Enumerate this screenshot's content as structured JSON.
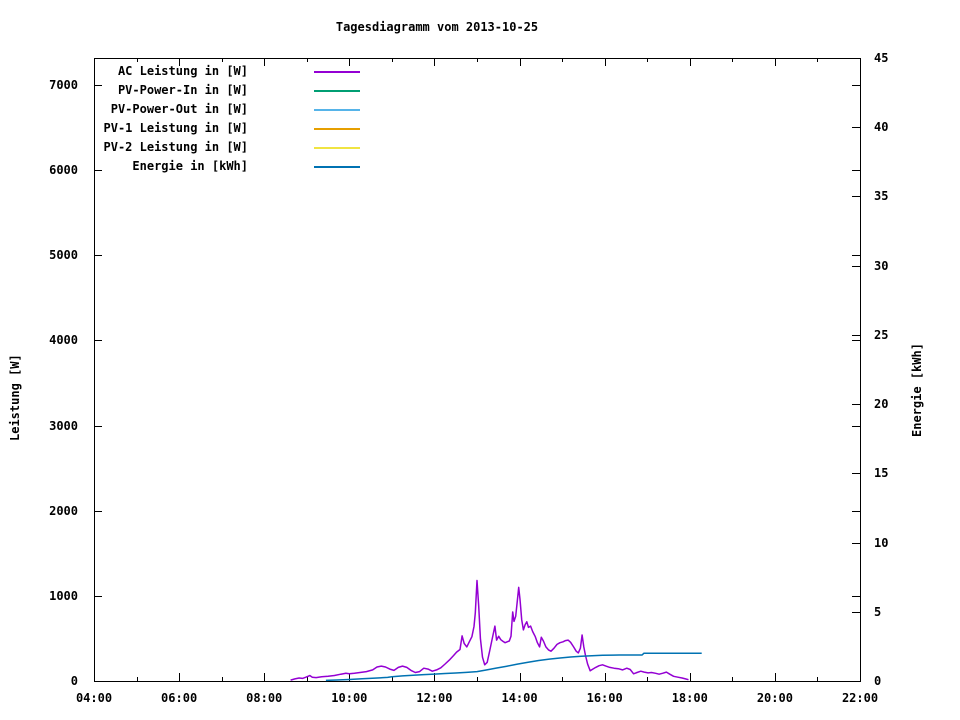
{
  "chart_data": {
    "type": "line",
    "title": "Tagesdiagramm vom 2013-10-25",
    "grid": false,
    "legend_position": "top-left-inside",
    "x_axis": {
      "range_hours": [
        4,
        22
      ],
      "ticks": [
        {
          "h": 4,
          "label": "04:00"
        },
        {
          "h": 6,
          "label": "06:00"
        },
        {
          "h": 8,
          "label": "08:00"
        },
        {
          "h": 10,
          "label": "10:00"
        },
        {
          "h": 12,
          "label": "12:00"
        },
        {
          "h": 14,
          "label": "14:00"
        },
        {
          "h": 16,
          "label": "16:00"
        },
        {
          "h": 18,
          "label": "18:00"
        },
        {
          "h": 20,
          "label": "20:00"
        },
        {
          "h": 22,
          "label": "22:00"
        }
      ],
      "minor_hours": [
        5,
        7,
        9,
        11,
        13,
        15,
        17,
        19,
        21
      ]
    },
    "y_left": {
      "label": "Leistung [W]",
      "range": [
        0,
        7318
      ],
      "ticks": [
        0,
        1000,
        2000,
        3000,
        4000,
        5000,
        6000,
        7000
      ]
    },
    "y_right": {
      "label": "Energie [kWh]",
      "range": [
        0,
        45
      ],
      "ticks": [
        0,
        5,
        10,
        15,
        20,
        25,
        30,
        35,
        40,
        45
      ]
    },
    "series": [
      {
        "name": "AC Leistung in [W]",
        "color": "#9400d3",
        "axis": "left",
        "points": [
          [
            8.62,
            10
          ],
          [
            8.72,
            25
          ],
          [
            8.82,
            35
          ],
          [
            8.9,
            30
          ],
          [
            8.98,
            45
          ],
          [
            9.07,
            65
          ],
          [
            9.13,
            45
          ],
          [
            9.22,
            40
          ],
          [
            9.35,
            50
          ],
          [
            9.5,
            55
          ],
          [
            9.65,
            65
          ],
          [
            9.8,
            80
          ],
          [
            9.92,
            90
          ],
          [
            10.0,
            85
          ],
          [
            10.12,
            90
          ],
          [
            10.25,
            100
          ],
          [
            10.4,
            110
          ],
          [
            10.55,
            130
          ],
          [
            10.65,
            165
          ],
          [
            10.75,
            175
          ],
          [
            10.85,
            165
          ],
          [
            10.95,
            140
          ],
          [
            11.05,
            125
          ],
          [
            11.15,
            160
          ],
          [
            11.25,
            175
          ],
          [
            11.35,
            160
          ],
          [
            11.45,
            125
          ],
          [
            11.55,
            100
          ],
          [
            11.65,
            110
          ],
          [
            11.75,
            150
          ],
          [
            11.85,
            140
          ],
          [
            11.95,
            115
          ],
          [
            12.05,
            130
          ],
          [
            12.15,
            155
          ],
          [
            12.25,
            200
          ],
          [
            12.35,
            245
          ],
          [
            12.45,
            300
          ],
          [
            12.52,
            340
          ],
          [
            12.6,
            370
          ],
          [
            12.65,
            530
          ],
          [
            12.7,
            440
          ],
          [
            12.76,
            400
          ],
          [
            12.82,
            460
          ],
          [
            12.88,
            520
          ],
          [
            12.93,
            640
          ],
          [
            12.96,
            800
          ],
          [
            13.0,
            1180
          ],
          [
            13.04,
            880
          ],
          [
            13.08,
            500
          ],
          [
            13.13,
            280
          ],
          [
            13.18,
            190
          ],
          [
            13.24,
            220
          ],
          [
            13.3,
            360
          ],
          [
            13.36,
            500
          ],
          [
            13.42,
            645
          ],
          [
            13.46,
            480
          ],
          [
            13.51,
            525
          ],
          [
            13.56,
            485
          ],
          [
            13.61,
            465
          ],
          [
            13.66,
            450
          ],
          [
            13.71,
            460
          ],
          [
            13.76,
            470
          ],
          [
            13.8,
            525
          ],
          [
            13.84,
            810
          ],
          [
            13.87,
            700
          ],
          [
            13.91,
            760
          ],
          [
            13.95,
            950
          ],
          [
            13.98,
            1100
          ],
          [
            14.01,
            960
          ],
          [
            14.05,
            720
          ],
          [
            14.09,
            600
          ],
          [
            14.13,
            660
          ],
          [
            14.17,
            695
          ],
          [
            14.21,
            630
          ],
          [
            14.26,
            645
          ],
          [
            14.31,
            580
          ],
          [
            14.37,
            520
          ],
          [
            14.42,
            450
          ],
          [
            14.47,
            400
          ],
          [
            14.51,
            515
          ],
          [
            14.56,
            470
          ],
          [
            14.62,
            400
          ],
          [
            14.68,
            365
          ],
          [
            14.74,
            350
          ],
          [
            14.81,
            385
          ],
          [
            14.88,
            430
          ],
          [
            14.95,
            450
          ],
          [
            15.02,
            460
          ],
          [
            15.08,
            475
          ],
          [
            15.14,
            480
          ],
          [
            15.2,
            455
          ],
          [
            15.27,
            400
          ],
          [
            15.33,
            350
          ],
          [
            15.38,
            330
          ],
          [
            15.43,
            385
          ],
          [
            15.47,
            540
          ],
          [
            15.51,
            400
          ],
          [
            15.55,
            300
          ],
          [
            15.6,
            200
          ],
          [
            15.66,
            120
          ],
          [
            15.72,
            140
          ],
          [
            15.79,
            160
          ],
          [
            15.87,
            180
          ],
          [
            15.95,
            190
          ],
          [
            16.03,
            175
          ],
          [
            16.12,
            160
          ],
          [
            16.22,
            150
          ],
          [
            16.32,
            145
          ],
          [
            16.42,
            130
          ],
          [
            16.52,
            150
          ],
          [
            16.6,
            135
          ],
          [
            16.68,
            85
          ],
          [
            16.76,
            100
          ],
          [
            16.85,
            115
          ],
          [
            16.93,
            105
          ],
          [
            17.02,
            95
          ],
          [
            17.1,
            100
          ],
          [
            17.2,
            90
          ],
          [
            17.28,
            80
          ],
          [
            17.36,
            90
          ],
          [
            17.45,
            105
          ],
          [
            17.53,
            80
          ],
          [
            17.62,
            55
          ],
          [
            17.72,
            45
          ],
          [
            17.82,
            35
          ],
          [
            17.9,
            25
          ],
          [
            17.97,
            15
          ]
        ]
      },
      {
        "name": "PV-Power-In in [W]",
        "color": "#009e73",
        "axis": "left",
        "points": []
      },
      {
        "name": "PV-Power-Out in [W]",
        "color": "#56b4e9",
        "axis": "left",
        "points": []
      },
      {
        "name": "PV-1 Leistung in [W]",
        "color": "#e69f00",
        "axis": "left",
        "points": []
      },
      {
        "name": "PV-2 Leistung in [W]",
        "color": "#f0e442",
        "axis": "left",
        "points": []
      },
      {
        "name": "Energie in [kWh]",
        "color": "#0072b2",
        "axis": "right",
        "points": [
          [
            9.45,
            0.04
          ],
          [
            9.7,
            0.07
          ],
          [
            10.0,
            0.11
          ],
          [
            10.3,
            0.16
          ],
          [
            10.6,
            0.21
          ],
          [
            10.9,
            0.26
          ],
          [
            11.0,
            0.31
          ],
          [
            11.25,
            0.37
          ],
          [
            11.5,
            0.42
          ],
          [
            11.75,
            0.46
          ],
          [
            12.0,
            0.5
          ],
          [
            12.25,
            0.54
          ],
          [
            12.5,
            0.58
          ],
          [
            12.75,
            0.62
          ],
          [
            13.0,
            0.68
          ],
          [
            13.2,
            0.79
          ],
          [
            13.45,
            0.93
          ],
          [
            13.7,
            1.07
          ],
          [
            13.95,
            1.22
          ],
          [
            14.2,
            1.36
          ],
          [
            14.45,
            1.48
          ],
          [
            14.7,
            1.58
          ],
          [
            14.95,
            1.66
          ],
          [
            15.2,
            1.73
          ],
          [
            15.45,
            1.79
          ],
          [
            15.7,
            1.83
          ],
          [
            15.95,
            1.86
          ],
          [
            16.2,
            1.87
          ],
          [
            16.34,
            1.88
          ],
          [
            16.88,
            1.88
          ],
          [
            16.92,
            2.0
          ],
          [
            17.4,
            2.0
          ],
          [
            17.9,
            2.0
          ],
          [
            18.28,
            2.0
          ]
        ]
      }
    ]
  }
}
